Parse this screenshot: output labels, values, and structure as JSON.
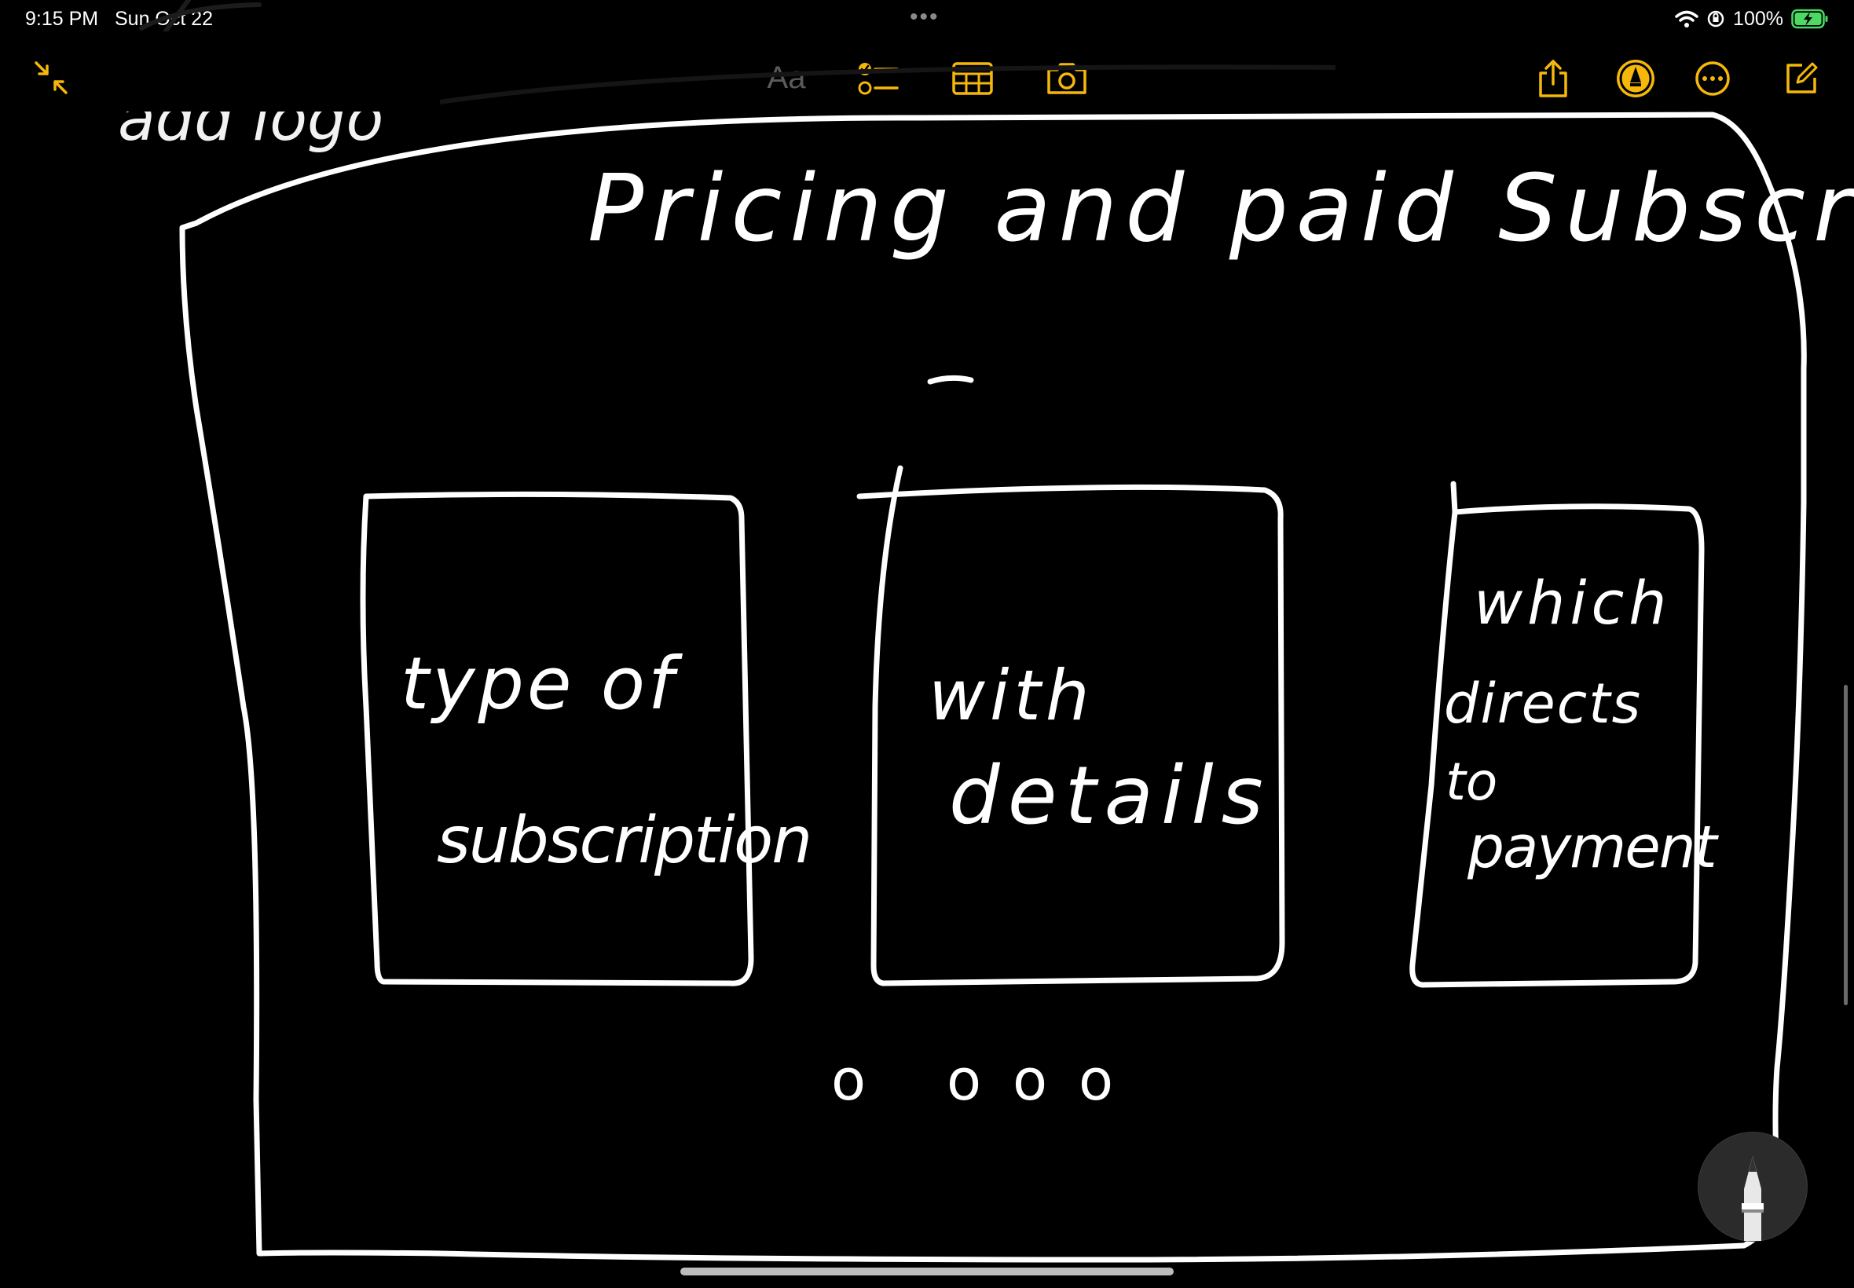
{
  "status_bar": {
    "time": "9:15 PM",
    "date": "Sun Oct 22",
    "battery": "100%"
  },
  "toolbar": {
    "format_label": "Aa",
    "icons": {
      "collapse": "collapse-arrows-icon",
      "checklist": "checklist-icon",
      "table": "table-icon",
      "camera": "camera-icon",
      "share": "share-icon",
      "markup": "markup-pen-icon",
      "more": "more-ellipsis-icon",
      "compose": "compose-icon"
    }
  },
  "note": {
    "top_left_text": "add logo",
    "title": "Pricing and paid Subscriptio",
    "boxes": [
      {
        "lines": [
          "type of",
          "subscription"
        ]
      },
      {
        "lines": [
          "with",
          "details"
        ]
      },
      {
        "lines": [
          "which",
          "directs",
          "to",
          "payment"
        ]
      }
    ],
    "pagination_dots": "o ooo"
  },
  "colors": {
    "accent": "#f5b80a",
    "background": "#000000",
    "ink": "#ffffff"
  }
}
